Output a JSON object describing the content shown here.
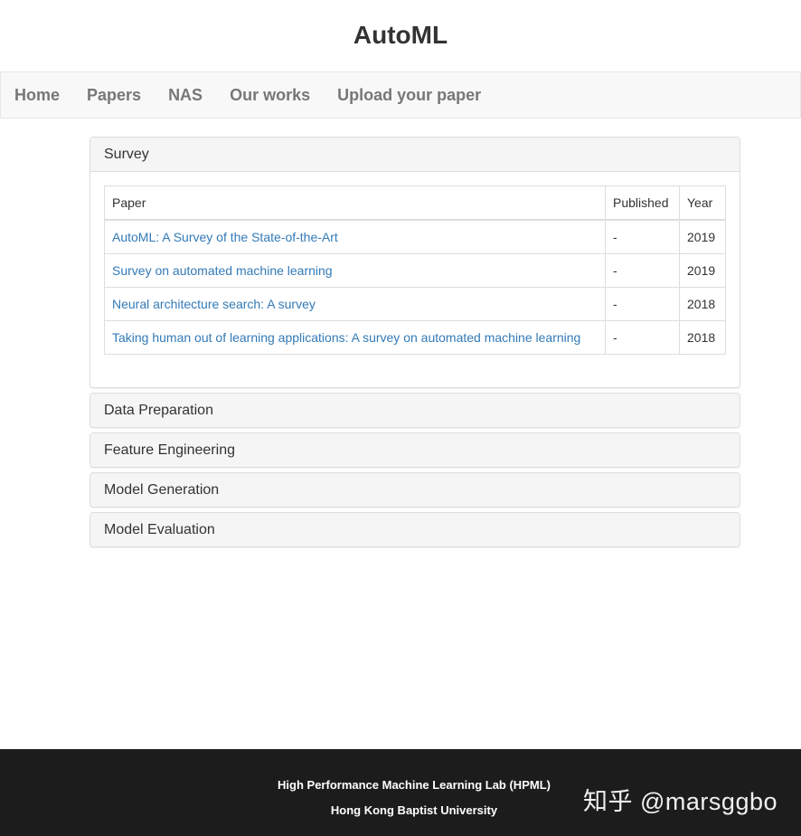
{
  "site": {
    "title": "AutoML"
  },
  "nav": {
    "items": [
      {
        "label": "Home"
      },
      {
        "label": "Papers"
      },
      {
        "label": "NAS"
      },
      {
        "label": "Our works"
      },
      {
        "label": "Upload your paper"
      }
    ]
  },
  "survey": {
    "heading": "Survey",
    "columns": {
      "paper": "Paper",
      "published": "Published",
      "year": "Year"
    },
    "rows": [
      {
        "paper": "AutoML: A Survey of the State-of-the-Art",
        "published": "-",
        "year": "2019"
      },
      {
        "paper": "Survey on automated machine learning",
        "published": "-",
        "year": "2019"
      },
      {
        "paper": "Neural architecture search: A survey",
        "published": "-",
        "year": "2018"
      },
      {
        "paper": "Taking human out of learning applications: A survey on automated machine learning",
        "published": "-",
        "year": "2018"
      }
    ]
  },
  "sections": [
    {
      "heading": "Data Preparation"
    },
    {
      "heading": "Feature Engineering"
    },
    {
      "heading": "Model Generation"
    },
    {
      "heading": "Model Evaluation"
    }
  ],
  "footer": {
    "line1": "High Performance Machine Learning Lab (HPML)",
    "line2": "Hong Kong Baptist University",
    "watermark": "知乎 @marsggbo"
  },
  "colors": {
    "link": "#337ab7",
    "footer_bg": "#1c1c1c",
    "navbar_bg": "#f8f8f8",
    "panel_heading_bg": "#f5f5f5"
  }
}
